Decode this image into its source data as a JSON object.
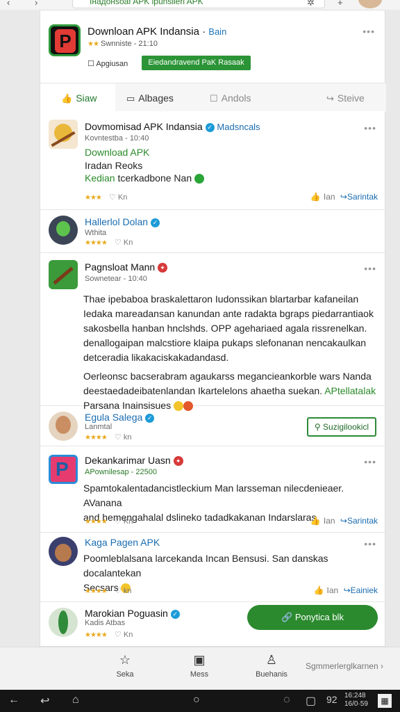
{
  "browser": {
    "url": "Інадонsoaf APK ipunsiieri APK"
  },
  "app_header": {
    "title": "Downloan APK Indansia ·",
    "publisher": "Bain",
    "rating_text": "Swnniste - 21:10",
    "sub_label": "Apgiusan",
    "action_label": "Eiedandravend PaK Rasaak",
    "tabs": [
      {
        "label": "Siaw",
        "icon": "like-icon"
      },
      {
        "label": "Albages",
        "icon": "comment-icon"
      },
      {
        "label": "Andols",
        "icon": "checkbox-icon"
      },
      {
        "label": "Steive",
        "icon": "share-icon"
      }
    ]
  },
  "posts": [
    {
      "name": "Dovmomisad APK Indansia",
      "tag": "Madsncals",
      "meta": "Kovntestba - 10:40",
      "lines": [
        "Download APK",
        "Iradan Reoks",
        "Kedian",
        "tcerkadbone Nan"
      ],
      "likes": "Kn",
      "action_left": "Ian",
      "action_right": "Sarintak"
    },
    {
      "name": "Hallerlol Dolan",
      "meta": "Wthita",
      "likes": "Kn"
    },
    {
      "name": "Pagnsloat Mann",
      "meta": "Sownetear - 10:40",
      "body": [
        "Thae ipebaboa braskalettaron Iudonssikan blartarbar kafaneilan",
        "Iedaka mareadansan kanundan ante radakta bgraps piedarrantiaok",
        "sakosbella hanban hnclshds. OPP agehariaed agala rissrenelkan.",
        "denallogaipan malcstiore klaipa pukaps slefonanan nencakaulkan",
        "detceradia likakaciskakadandasd.",
        "Oerleonsc bacserabram agaukarss megancieankorble wars Nanda",
        "deestaedadeibatenlandan Ikartelelons ahaetha suekan.",
        "Parsana Inainsisues"
      ],
      "body_highlight": "APtellatalak"
    },
    {
      "name": "Egula Salega",
      "meta": "Lanmtal",
      "likes": "kn",
      "button": "Suzigilookicl"
    },
    {
      "name": "Dekankarimar Uasn",
      "meta": "APownilesap - 22500",
      "body": [
        "Spamtokalentadancistleckium Man larsseman nilecdenieaer. AVanana",
        "and hemengahalal dslineko tadadkakanan Indarslaras."
      ],
      "likes": "Kn",
      "action_left": "Ian",
      "action_right": "Sarintak"
    },
    {
      "name": "Kaga Pagen APK",
      "body": [
        "Poomleblalsana larcekanda Incan Bensusi. San danskas docalantekan",
        "Secsars"
      ],
      "likes": "kn",
      "action_left": "Ian",
      "action_right": "Eainiek"
    },
    {
      "name": "Marokian Poguasin",
      "meta": "Kadis Atbas",
      "likes": "Kn",
      "button": "Ponytica blk"
    }
  ],
  "bottom_nav": {
    "items": [
      "Seka",
      "Mess",
      "Buehanis"
    ],
    "right": "Sgmmerlerglkarnen"
  },
  "system_bar": {
    "number": "92",
    "time_line1": "16:248",
    "time_line2": "16/0·59"
  },
  "colors": {
    "accent_green": "#2b9436",
    "link_blue": "#1a6cb0",
    "star": "#e8a91c"
  }
}
